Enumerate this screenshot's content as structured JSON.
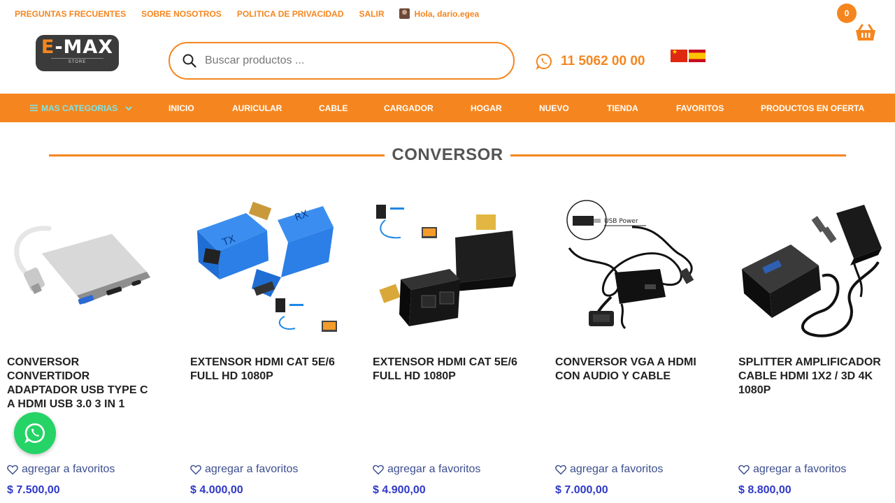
{
  "toplinks": {
    "faq": "PREGUNTAS FRECUENTES",
    "about": "SOBRE NOSOTROS",
    "privacy": "POLITICA DE PRIVACIDAD",
    "logout": "SALIR",
    "greeting": "Hola, dario.egea"
  },
  "cart": {
    "count": "0",
    "icon": "basket-icon"
  },
  "logo": {
    "brand_e": "E",
    "brand_rest": "-MAX",
    "sub": "STORE"
  },
  "search": {
    "placeholder": "Buscar productos ..."
  },
  "phone": {
    "number": "11 5062 00 00",
    "icon": "whatsapp-icon"
  },
  "flags": [
    "china-flag",
    "spain-flag"
  ],
  "nav": {
    "categories": "MAS CATEGORIAS",
    "items": [
      "INICIO",
      "AURICULAR",
      "CABLE",
      "CARGADOR",
      "HOGAR",
      "NUEVO",
      "TIENDA",
      "FAVORITOS",
      "PRODUCTOS EN OFERTA"
    ]
  },
  "section": {
    "title": "CONVERSOR"
  },
  "products": [
    {
      "name": "CONVERSOR CONVERTIDOR ADAPTADOR USB TYPE C A HDMI USB 3.0 3 IN 1",
      "fav": "agregar a favoritos",
      "price": "$ 7.500,00"
    },
    {
      "name": "EXTENSOR HDMI CAT 5E/6 FULL HD 1080P",
      "fav": "agregar a favoritos",
      "price": "$ 4.000,00"
    },
    {
      "name": "EXTENSOR HDMI CAT 5E/6 FULL HD 1080P",
      "fav": "agregar a favoritos",
      "price": "$ 4.900,00"
    },
    {
      "name": "CONVERSOR VGA A HDMI CON AUDIO Y CABLE",
      "fav": "agregar a favoritos",
      "price": "$ 7.000,00"
    },
    {
      "name": "SPLITTER AMPLIFICADOR CABLE HDMI 1X2 / 3D 4K 1080P",
      "fav": "agregar a favoritos",
      "price": "$ 8.800,00"
    }
  ],
  "colors": {
    "accent": "#f5861f",
    "price": "#2e39c6",
    "whatsapp": "#25d366"
  }
}
